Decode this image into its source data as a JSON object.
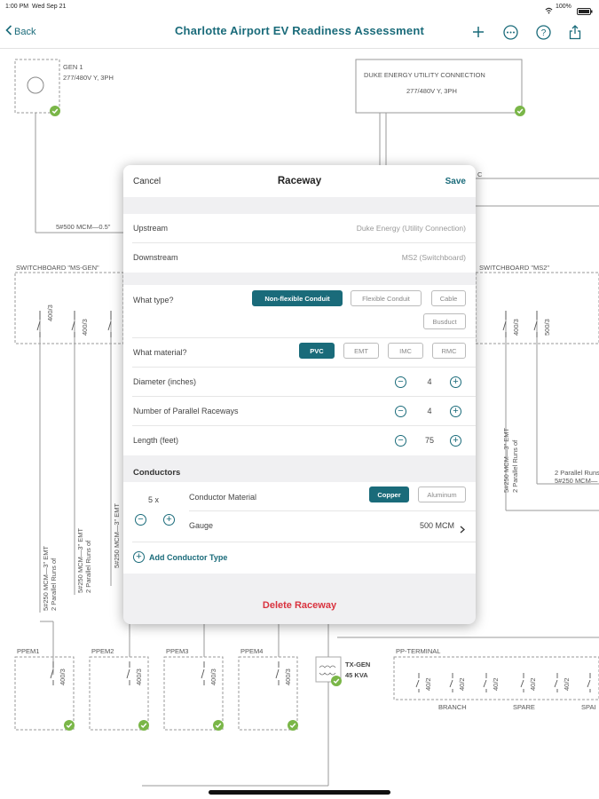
{
  "status_bar": {
    "time": "1:00 PM",
    "date": "Wed Sep 21",
    "battery": "100%"
  },
  "nav": {
    "back_label": "Back",
    "title": "Charlotte Airport EV Readiness Assessment"
  },
  "diagram": {
    "gen1": {
      "name": "GEN 1",
      "spec": "277/480V Y, 3PH"
    },
    "utility": {
      "name": "DUKE ENERGY UTILITY CONNECTION",
      "spec": "277/480V Y, 3PH"
    },
    "feeder_label": "5#500 MCM—0.5\"",
    "right_stub_label": "C",
    "switchboard_left": "SWITCHBOARD \"MS-GEN\"",
    "switchboard_right": "SWITCHBOARD \"MS2\"",
    "breaker_400": "400/3",
    "breaker_500": "500/3",
    "feed_label_1": "5#250 MCM—3\" EMT",
    "feed_label_2": "2 Parallel Runs of",
    "right_feed_1": "2 Parallel Runs of",
    "right_feed_2": "5#250 MCM—",
    "panels": [
      "PPEM1",
      "PPEM2",
      "PPEM3",
      "PPEM4"
    ],
    "panel_breaker": "400/3",
    "tx": {
      "name": "TX-GEN",
      "spec": "45 KVA"
    },
    "pp_terminal": "PP-TERMINAL",
    "pp_breaker": "40/2",
    "branch": "BRANCH",
    "spare": "SPARE",
    "spare2": "SPAI"
  },
  "modal": {
    "cancel": "Cancel",
    "title": "Raceway",
    "save": "Save",
    "upstream_label": "Upstream",
    "upstream_value": "Duke Energy (Utility Connection)",
    "downstream_label": "Downstream",
    "downstream_value": "MS2 (Switchboard)",
    "type_label": "What type?",
    "type_options": [
      "Non-flexible Conduit",
      "Flexible Conduit",
      "Cable",
      "Busduct"
    ],
    "type_selected": "Non-flexible Conduit",
    "material_label": "What material?",
    "material_options": [
      "PVC",
      "EMT",
      "IMC",
      "RMC"
    ],
    "material_selected": "PVC",
    "diameter_label": "Diameter (inches)",
    "diameter_value": "4",
    "parallel_label": "Number of Parallel Raceways",
    "parallel_value": "4",
    "length_label": "Length (feet)",
    "length_value": "75",
    "conductors_header": "Conductors",
    "conductor_count": "5 x",
    "conductor_material_label": "Conductor Material",
    "conductor_material_options": [
      "Copper",
      "Aluminum"
    ],
    "conductor_material_selected": "Copper",
    "gauge_label": "Gauge",
    "gauge_value": "500 MCM",
    "add_conductor": "Add Conductor Type",
    "delete": "Delete Raceway"
  },
  "colors": {
    "accent": "#1a6b7a",
    "danger": "#d9333f",
    "ok": "#7ab648"
  }
}
